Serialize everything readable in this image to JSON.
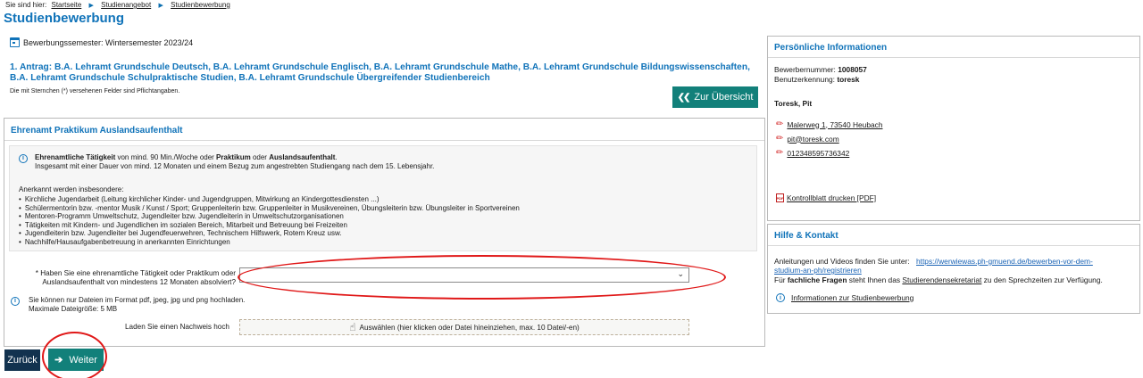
{
  "breadcrumb": {
    "prefix": "Sie sind hier:",
    "items": [
      "Startseite",
      "Studienangebot",
      "Studienbewerbung"
    ]
  },
  "page_title": "Studienbewerbung",
  "semester": "Bewerbungssemester: Wintersemester 2023/24",
  "antrag_title": "1. Antrag: B.A. Lehramt Grundschule Deutsch, B.A. Lehramt Grundschule Englisch, B.A. Lehramt Grundschule Mathe, B.A. Lehramt Grundschule Bildungswissenschaften, B.A. Lehramt Grundschule Schulpraktische Studien, B.A. Lehramt Grundschule Übergreifender Studienbereich",
  "pflicht_note": "Die mit Sternchen (*) versehenen Felder sind Pflichtangaben.",
  "overview_button": "Zur Übersicht",
  "main": {
    "title": "Ehrenamt Praktikum Auslandsaufenthalt",
    "info": {
      "part1_bold": "Ehrenamtliche Tätigkeit",
      "part2": " von mind. 90 Min./Woche oder ",
      "part3_bold": "Praktikum",
      "part4": " oder ",
      "part5_bold": "Auslandsaufenthalt",
      "part6": ".",
      "line2": "Insgesamt mit einer Dauer von mind. 12 Monaten und einem Bezug zum angestrebten Studiengang nach dem 15. Lebensjahr.",
      "anerkannt": "Anerkannt werden insbesondere:",
      "items": [
        "Kirchliche Jugendarbeit (Leitung kirchlicher Kinder- und Jugendgruppen, Mitwirkung an Kindergottesdiensten ...)",
        "Schülermentorin bzw. -mentor Musik / Kunst / Sport; Gruppenleiterin bzw. Gruppenleiter in Musikvereinen, Übungsleiterin bzw. Übungsleiter in Sportvereinen",
        "Mentoren-Programm Umweltschutz, Jugendleiter bzw. Jugendleiterin in Umweltschutzorganisationen",
        "Tätigkeiten mit Kindern- und Jugendlichen im sozialen Bereich, Mitarbeit und Betreuung bei Freizeiten",
        "Jugendleiterin bzw. Jugendleiter bei Jugendfeuerwehren, Technischem Hilfswerk, Rotem Kreuz usw.",
        "Nachhilfe/Hausaufgabenbetreuung in anerkannten Einrichtungen"
      ]
    },
    "question": "* Haben Sie eine ehrenamtliche Tätigkeit oder Praktikum oder Auslandsaufenthalt von mindestens 12 Monaten absolviert?",
    "select_value": "",
    "upload_note_line1": "Sie können nur Dateien im Format pdf, jpeg, jpg und png hochladen.",
    "upload_note_line2": "Maximale Dateigröße: 5 MB",
    "nachweis_label": "Laden Sie einen Nachweis hoch",
    "dropzone_text": "Auswählen (hier klicken oder Datei hineinziehen, max. 10 Datei/-en)"
  },
  "buttons": {
    "back": "Zurück",
    "next": "Weiter"
  },
  "personal": {
    "title": "Persönliche Informationen",
    "bewerbernummer_label": "Bewerbernummer: ",
    "bewerbernummer": "1008057",
    "benutzerkennung_label": "Benutzerkennung: ",
    "benutzerkennung": "toresk",
    "name": "Toresk, Pit",
    "address": "Malerweg 1, 73540 Heubach",
    "email": "pit@toresk.com",
    "phone": "012348595736342",
    "kontrollblatt": "Kontrollblatt drucken [PDF]"
  },
  "help": {
    "title": "Hilfe & Kontakt",
    "videos_text": "Anleitungen und Videos finden Sie unter:",
    "url": "https://werwiewas.ph-gmuend.de/bewerben-vor-dem-studium-an-ph/registrieren",
    "url_line1": "https://werwiewas.ph-gmuend.de/bewerben-vor-dem-",
    "url_line2": "studium-an-ph/registrieren",
    "questions_pre": "Für ",
    "questions_bold": "fachliche Fragen",
    "questions_mid": " steht Ihnen das ",
    "questions_link": "Studierendensekretariat",
    "questions_post": " zu den Sprechzeiten zur Verfügung.",
    "info_link": "Informationen zur Studienbewerbung"
  },
  "colors": {
    "brand_blue": "#1073b9",
    "teal_button": "#12807a",
    "dark_button": "#12324f",
    "annotation_red": "#e01818"
  }
}
